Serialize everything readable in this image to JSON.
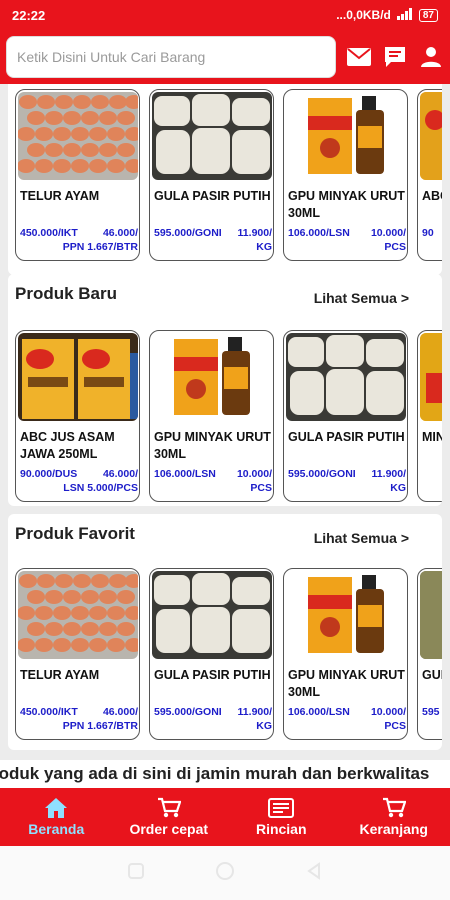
{
  "status": {
    "time": "22:22",
    "network": "...0,0KB/d",
    "battery": "87"
  },
  "search": {
    "placeholder": "Ketik Disini Untuk Cari Barang"
  },
  "header_icons": [
    "mail-icon",
    "chat-icon",
    "user-icon"
  ],
  "sections": [
    {
      "title": "",
      "link": "",
      "products": [
        {
          "name": "TELUR AYAM",
          "price_left": "450.000/IKT",
          "price_right": "46.000/",
          "price_line2": "PPN 1.667/BTR",
          "image": "eggs"
        },
        {
          "name": "GULA PASIR PUTIH",
          "price_left": "595.000/GONI",
          "price_right": "11.900/",
          "price_line2": "KG",
          "image": "sugar"
        },
        {
          "name": "GPU MINYAK URUT 30ML",
          "price_left": "106.000/LSN",
          "price_right": "10.000/",
          "price_line2": "PCS",
          "image": "gpu"
        },
        {
          "name": "ABC JAWA",
          "price_left": "90",
          "price_right": "",
          "price_line2": "",
          "image": "abc"
        }
      ]
    },
    {
      "title": "Produk Baru",
      "link": "Lihat Semua >",
      "products": [
        {
          "name": "ABC JUS ASAM JAWA 250ML",
          "price_left": "90.000/DUS",
          "price_right": "46.000/",
          "price_line2": "LSN 5.000/PCS",
          "image": "abc"
        },
        {
          "name": "GPU MINYAK URUT 30ML",
          "price_left": "106.000/LSN",
          "price_right": "10.000/",
          "price_line2": "PCS",
          "image": "gpu"
        },
        {
          "name": "GULA PASIR PUTIH",
          "price_left": "595.000/GONI",
          "price_right": "11.900/",
          "price_line2": "KG",
          "image": "sugar"
        },
        {
          "name": "MIN",
          "price_left": "",
          "price_right": "",
          "price_line2": "",
          "image": "oil"
        }
      ]
    },
    {
      "title": "Produk Favorit",
      "link": "Lihat Semua >",
      "products": [
        {
          "name": "TELUR AYAM",
          "price_left": "450.000/IKT",
          "price_right": "46.000/",
          "price_line2": "PPN 1.667/BTR",
          "image": "eggs"
        },
        {
          "name": "GULA PASIR PUTIH",
          "price_left": "595.000/GONI",
          "price_right": "11.900/",
          "price_line2": "KG",
          "image": "sugar"
        },
        {
          "name": "GPU MINYAK URUT 30ML",
          "price_left": "106.000/LSN",
          "price_right": "10.000/",
          "price_line2": "PCS",
          "image": "gpu"
        },
        {
          "name": "GUL KUI",
          "price_left": "595",
          "price_right": "",
          "price_line2": "",
          "image": "sack"
        }
      ]
    }
  ],
  "marquee": "roduk yang ada di sini di jamin murah dan berkwalitas",
  "bottom_nav": [
    {
      "label": "Beranda",
      "icon": "home-icon",
      "active": true
    },
    {
      "label": "Order cepat",
      "icon": "cart-icon",
      "active": false
    },
    {
      "label": "Rincian",
      "icon": "receipt-icon",
      "active": false
    },
    {
      "label": "Keranjang",
      "icon": "basket-icon",
      "active": false
    }
  ],
  "colors": {
    "brand": "#e8141c",
    "price": "#1d1dc9",
    "active_nav": "#8fe0ff"
  }
}
